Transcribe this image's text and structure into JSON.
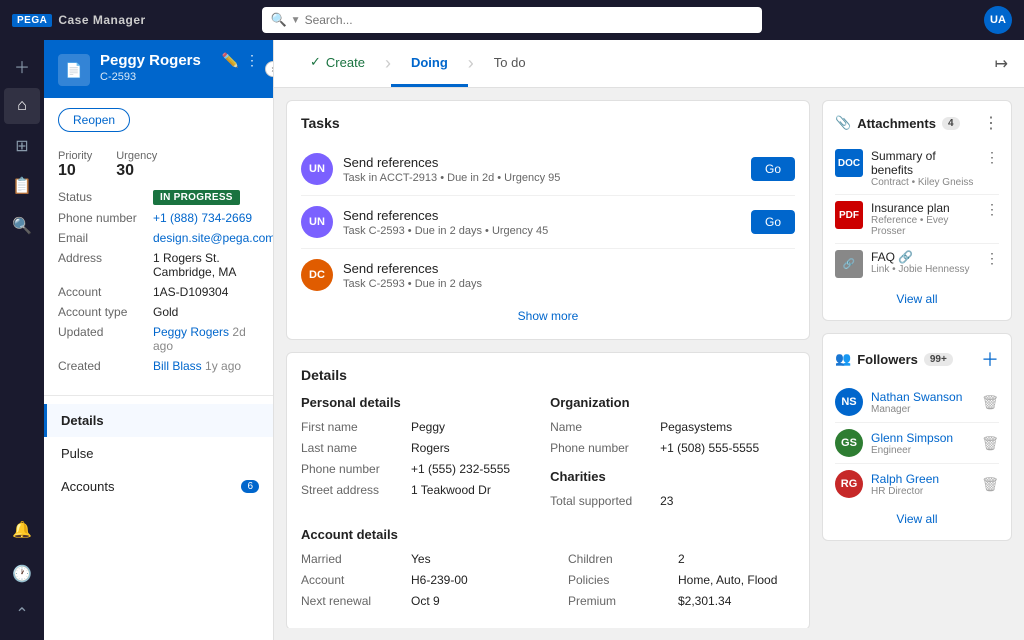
{
  "topbar": {
    "logo": "PEGA",
    "app": "Case Manager",
    "search_placeholder": "Search...",
    "avatar": "UA"
  },
  "left_panel": {
    "case_name": "Peggy Rogers",
    "case_id": "C-2593",
    "reopen_label": "Reopen",
    "priority_label": "Priority",
    "priority_value": "10",
    "urgency_label": "Urgency",
    "urgency_value": "30",
    "status_label": "Status",
    "status_value": "IN PROGRESS",
    "phone_label": "Phone number",
    "phone_value": "+1 (888) 734-2669",
    "email_label": "Email",
    "email_value": "design.site@pega.com",
    "address_label": "Address",
    "address_value": "1 Rogers St. Cambridge, MA",
    "account_label": "Account",
    "account_value": "1AS-D109304",
    "account_type_label": "Account type",
    "account_type_value": "Gold",
    "updated_label": "Updated",
    "updated_value": "Peggy Rogers",
    "updated_time": "2d ago",
    "created_label": "Created",
    "created_value": "Bill Blass",
    "created_time": "1y ago",
    "nav_items": [
      {
        "label": "Details",
        "active": true,
        "count": null
      },
      {
        "label": "Pulse",
        "active": false,
        "count": null
      },
      {
        "label": "Accounts",
        "active": false,
        "count": "6"
      }
    ]
  },
  "stages": [
    {
      "label": "Create",
      "state": "completed"
    },
    {
      "label": "Doing",
      "state": "active"
    },
    {
      "label": "To do",
      "state": "inactive"
    }
  ],
  "tasks": {
    "title": "Tasks",
    "items": [
      {
        "initials": "UN",
        "color": "#7b61ff",
        "title": "Send references",
        "subtitle": "Task in ACCT-2913 • Due in 2d • Urgency 95",
        "btn": "Go"
      },
      {
        "initials": "UN",
        "color": "#7b61ff",
        "title": "Send references",
        "subtitle": "Task C-2593 • Due in 2 days • Urgency 45",
        "btn": "Go"
      },
      {
        "initials": "DC",
        "color": "#e05c00",
        "title": "Send references",
        "subtitle": "Task C-2593 • Due in 2 days",
        "btn": null
      }
    ],
    "show_more": "Show more"
  },
  "details": {
    "title": "Details",
    "personal": {
      "section_title": "Personal details",
      "fields": [
        {
          "label": "First name",
          "value": "Peggy"
        },
        {
          "label": "Last name",
          "value": "Rogers"
        },
        {
          "label": "Phone number",
          "value": "+1 (555) 232-5555"
        },
        {
          "label": "Street address",
          "value": "1 Teakwood Dr"
        }
      ]
    },
    "organization": {
      "section_title": "Organization",
      "fields": [
        {
          "label": "Name",
          "value": "Pegasystems"
        },
        {
          "label": "Phone number",
          "value": "+1 (508) 555-5555"
        }
      ]
    },
    "charities": {
      "section_title": "Charities",
      "fields": [
        {
          "label": "Total supported",
          "value": "23"
        }
      ]
    },
    "account": {
      "section_title": "Account details",
      "fields": [
        {
          "label": "Married",
          "value": "Yes"
        },
        {
          "label": "Children",
          "value": "2"
        },
        {
          "label": "Account",
          "value": "H6-239-00"
        },
        {
          "label": "Policies",
          "value": "Home, Auto, Flood"
        },
        {
          "label": "Next renewal",
          "value": "Oct 9"
        },
        {
          "label": "Premium",
          "value": "$2,301.34"
        }
      ]
    }
  },
  "attachments": {
    "title": "Attachments",
    "count": "4",
    "items": [
      {
        "type": "doc",
        "color": "blue",
        "label": "DOC",
        "name": "Summary of benefits",
        "sub": "Contract • Kiley Gneiss"
      },
      {
        "type": "pdf",
        "color": "red",
        "label": "PDF",
        "name": "Insurance plan",
        "sub": "Reference • Evey Prosser"
      },
      {
        "type": "link",
        "color": "gray",
        "label": "🔗",
        "name": "FAQ",
        "sub": "Link • Jobie Hennessy"
      }
    ],
    "view_all": "View all"
  },
  "followers": {
    "title": "Followers",
    "count": "99+",
    "items": [
      {
        "initials": "NS",
        "color": "#0066cc",
        "name": "Nathan Swanson",
        "role": "Manager"
      },
      {
        "initials": "GS",
        "color": "#2e7d32",
        "name": "Glenn Simpson",
        "role": "Engineer"
      },
      {
        "initials": "RG",
        "color": "#c62828",
        "name": "Ralph Green",
        "role": "HR Director"
      }
    ],
    "view_all": "View all"
  }
}
